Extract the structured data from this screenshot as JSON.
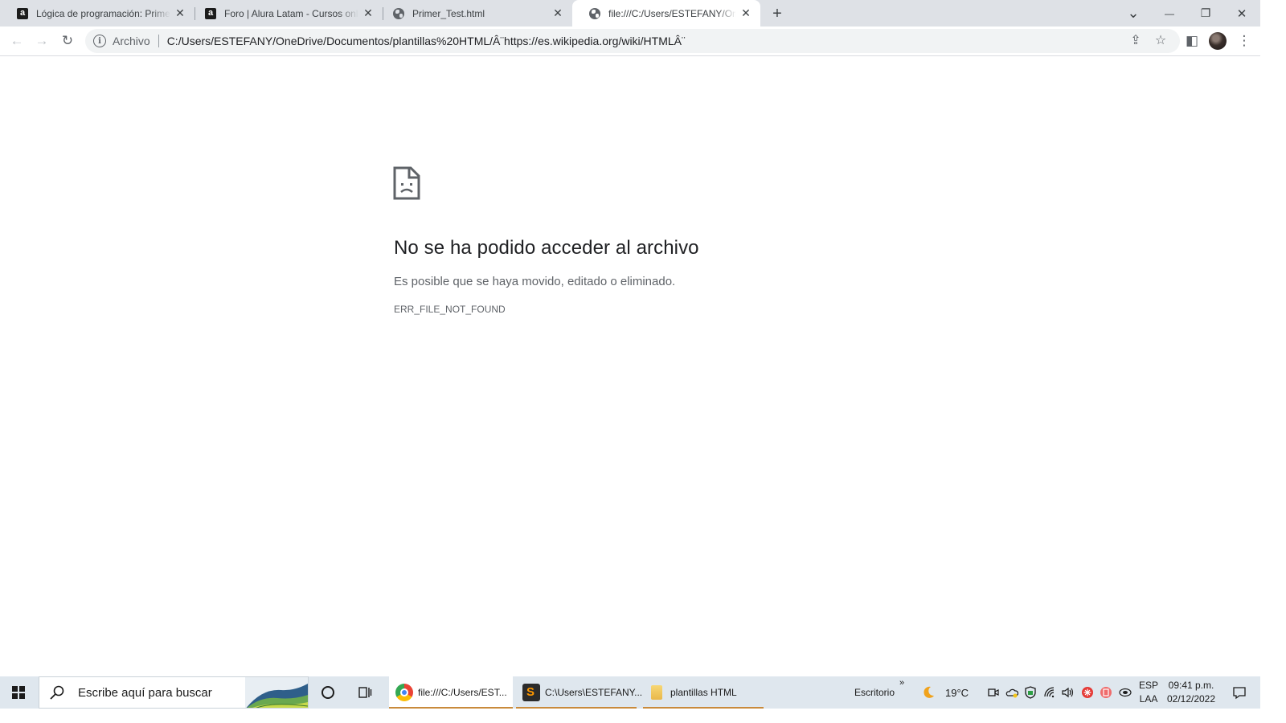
{
  "browser": {
    "tabs": [
      {
        "title": "Lógica de programación: Primeros pasos",
        "favicon": "alura-icon",
        "active": false
      },
      {
        "title": "Foro | Alura Latam - Cursos online",
        "favicon": "alura-icon",
        "active": false
      },
      {
        "title": "Primer_Test.html",
        "favicon": "globe-icon",
        "active": false
      },
      {
        "title": "file:///C:/Users/ESTEFANY/OneDrive",
        "favicon": "globe-icon",
        "active": true
      }
    ],
    "favicon_letter": "a",
    "new_tab_symbol": "+",
    "window_controls": {
      "tab_search": "⌄",
      "minimize": "—",
      "restore": "❐",
      "close": "✕"
    }
  },
  "toolbar": {
    "back_symbol": "←",
    "forward_symbol": "→",
    "reload_symbol": "↻",
    "site_info_symbol": "i",
    "origin_chip": "Archivo",
    "url": "C:/Users/ESTEFANY/OneDrive/Documentos/plantillas%20HTML/Â¨https://es.wikipedia.org/wiki/HTMLÂ¨",
    "share_symbol": "⇪",
    "bookmark_symbol": "☆",
    "side_panel_symbol": "◧",
    "menu_symbol": "⋮"
  },
  "error_page": {
    "title": "No se ha podido acceder al archivo",
    "description": "Es posible que se haya movido, editado o eliminado.",
    "code": "ERR_FILE_NOT_FOUND"
  },
  "taskbar": {
    "search_placeholder": "Escribe aquí para buscar",
    "apps": [
      {
        "label": "file:///C:/Users/EST...",
        "icon": "chrome-icon",
        "active": true
      },
      {
        "label": "C:\\Users\\ESTEFANY...",
        "icon": "sublime-text-icon",
        "active": false
      },
      {
        "label": "plantillas HTML",
        "icon": "folder-icon",
        "active": false
      }
    ],
    "desktop_label": "Escritorio",
    "overflow_symbol": "»",
    "weather": {
      "temperature": "19°C",
      "icon": "moon-icon"
    },
    "language": {
      "line1": "ESP",
      "line2": "LAA"
    },
    "clock": {
      "time": "09:41 p.m.",
      "date": "02/12/2022"
    }
  },
  "colors": {
    "tabstrip_bg": "#dee1e6",
    "omnibox_bg": "#f1f3f4",
    "taskbar_bg": "#dfe7ee",
    "taskbar_active_underline": "#c98a3b",
    "error_title": "#202124",
    "error_text": "#5f6368"
  }
}
